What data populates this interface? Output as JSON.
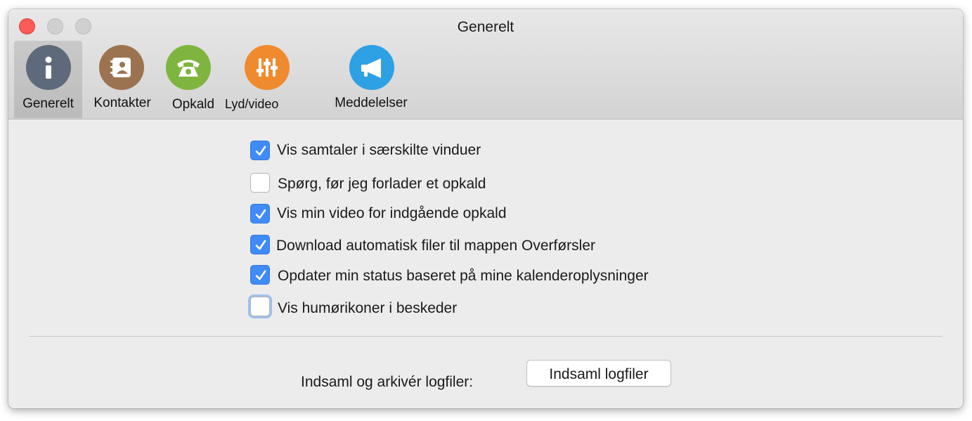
{
  "window": {
    "title": "Generelt"
  },
  "tabs": [
    {
      "label": "Generelt",
      "icon": "info-icon",
      "color": "#5e6a7c",
      "selected": true
    },
    {
      "label": "Kontakter",
      "icon": "contact-book-icon",
      "color": "#9c7350",
      "selected": false
    },
    {
      "label": "Opkald",
      "icon": "phone-icon",
      "color": "#7fb53e",
      "selected": false
    },
    {
      "label": "Lyd/video",
      "icon": "sliders-icon",
      "color": "#f08a2e",
      "selected": false
    },
    {
      "label": "Meddelelser",
      "icon": "megaphone-icon",
      "color": "#2ea0e4",
      "selected": false
    }
  ],
  "options": [
    {
      "label": "Vis samtaler i særskilte vinduer",
      "checked": true
    },
    {
      "label": "Spørg, før jeg forlader et opkald",
      "checked": false
    },
    {
      "label": "Vis min video for indgående opkald",
      "checked": true
    },
    {
      "label": "Download automatisk filer til mappen Overførsler",
      "checked": true
    },
    {
      "label": "Opdater min status baseret på mine kalenderoplysninger",
      "checked": true
    },
    {
      "label": "Vis humørikoner i beskeder",
      "checked": false
    }
  ],
  "logs": {
    "label": "Indsaml og arkivér logfiler:",
    "button_label": "Indsaml logfiler"
  },
  "colors": {
    "checkbox_checked": "#3f8bf7",
    "close_button": "#fc5b57"
  }
}
